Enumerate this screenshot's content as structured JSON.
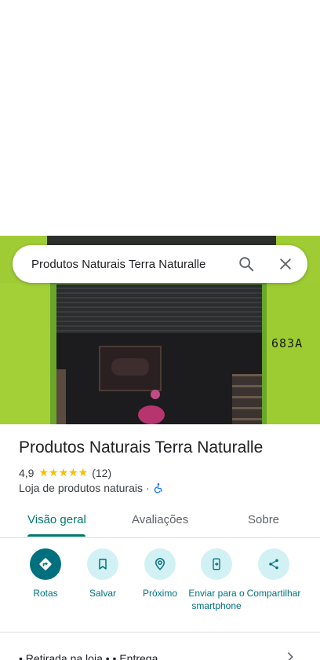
{
  "search": {
    "query": "Produtos Naturais Terra Naturalle"
  },
  "photo": {
    "door_number": "683A"
  },
  "place": {
    "name": "Produtos Naturais Terra Naturalle",
    "rating": "4,9",
    "stars": "★★★★★",
    "review_count": "(12)",
    "category": "Loja de produtos naturais",
    "separator": "·"
  },
  "tabs": [
    {
      "label": "Visão geral",
      "active": true
    },
    {
      "label": "Avaliações",
      "active": false
    },
    {
      "label": "Sobre",
      "active": false
    }
  ],
  "actions": [
    {
      "label": "Rotas",
      "icon": "directions-icon"
    },
    {
      "label": "Salvar",
      "icon": "bookmark-icon"
    },
    {
      "label": "Próximo",
      "icon": "nearby-icon"
    },
    {
      "label": "Enviar para o smartphone",
      "icon": "send-to-phone-icon"
    },
    {
      "label": "Compartilhar",
      "icon": "share-icon"
    }
  ],
  "bottom": {
    "text": "• Retirada na loja • • Entrega"
  },
  "colors": {
    "accent": "#00707f",
    "tab_active": "#00796b",
    "star": "#fbbc04",
    "action_bg": "#d2f1f4"
  }
}
